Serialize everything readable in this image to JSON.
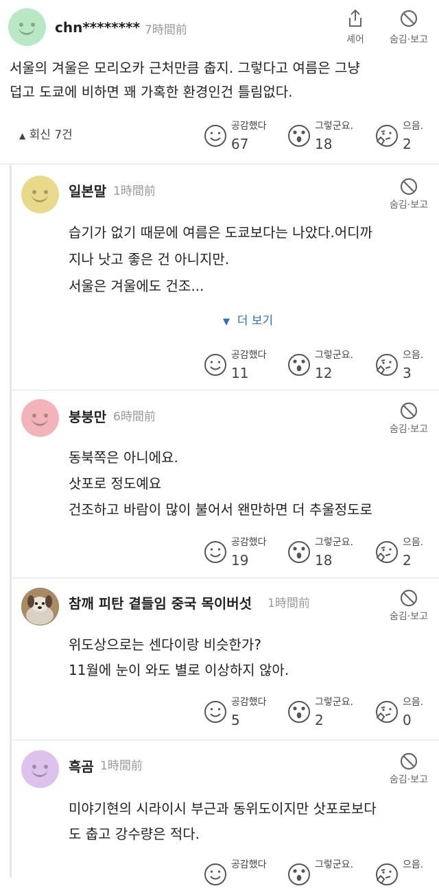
{
  "post": {
    "username": "chn********",
    "time": "7時間前",
    "share_label": "셰어",
    "hide_label": "숨김·보고",
    "lines": [
      "서울의 겨울은 모리오카 근처만큼 춥지. 그렇다고 여름은 그냥",
      "덥고 도쿄에 비하면 꽤 가혹한 환경인건 틀림없다."
    ],
    "replies_label": "회신 7건",
    "reactions": {
      "agree": "67",
      "surprise": "18",
      "hmm": "2"
    }
  },
  "reaction_labels": {
    "agree": "공감했다",
    "surprise": "그렇군요.",
    "hmm": "으음."
  },
  "comments": [
    {
      "username": "일본말",
      "time": "1時間前",
      "avatar_color": "#e9d98a",
      "lines": [
        "습기가 없기 때문에 여름은 도쿄보다는 나았다.어디까",
        "지나 낫고 좋은 건 아니지만.",
        "서울은 겨울에도 건조..."
      ],
      "more_label": "더 보기",
      "reactions": {
        "agree": "11",
        "surprise": "12",
        "hmm": "3"
      }
    },
    {
      "username": "붕붕만",
      "time": "6時間前",
      "avatar_color": "#f2b4b9",
      "lines": [
        "동북쪽은 아니에요.",
        "삿포로 정도예요",
        "건조하고 바람이 많이 불어서 왠만하면 더 추울정도로"
      ],
      "reactions": {
        "agree": "19",
        "surprise": "18",
        "hmm": "2"
      }
    },
    {
      "username": "참깨 피탄 곁들임 중국 목이버섯",
      "time": "1時間前",
      "avatar_color": "#8b6f4e",
      "lines": [
        "위도상으로는 센다이랑 비슷한가?",
        "11월에 눈이 와도 별로 이상하지 않아."
      ],
      "reactions": {
        "agree": "5",
        "surprise": "2",
        "hmm": "0"
      }
    },
    {
      "username": "흑곰",
      "time": "1時間前",
      "avatar_color": "#dcc2ec",
      "lines": [
        "미야기현의 시라이시 부근과 동위도이지만 삿포로보다",
        "도 춥고 강수량은 적다."
      ],
      "reactions": {
        "agree": "",
        "surprise": "",
        "hmm": ""
      }
    }
  ],
  "colors": {
    "link": "#2a6fc9",
    "divider": "#eceef1",
    "post_avatar": "#b9e8c4"
  }
}
